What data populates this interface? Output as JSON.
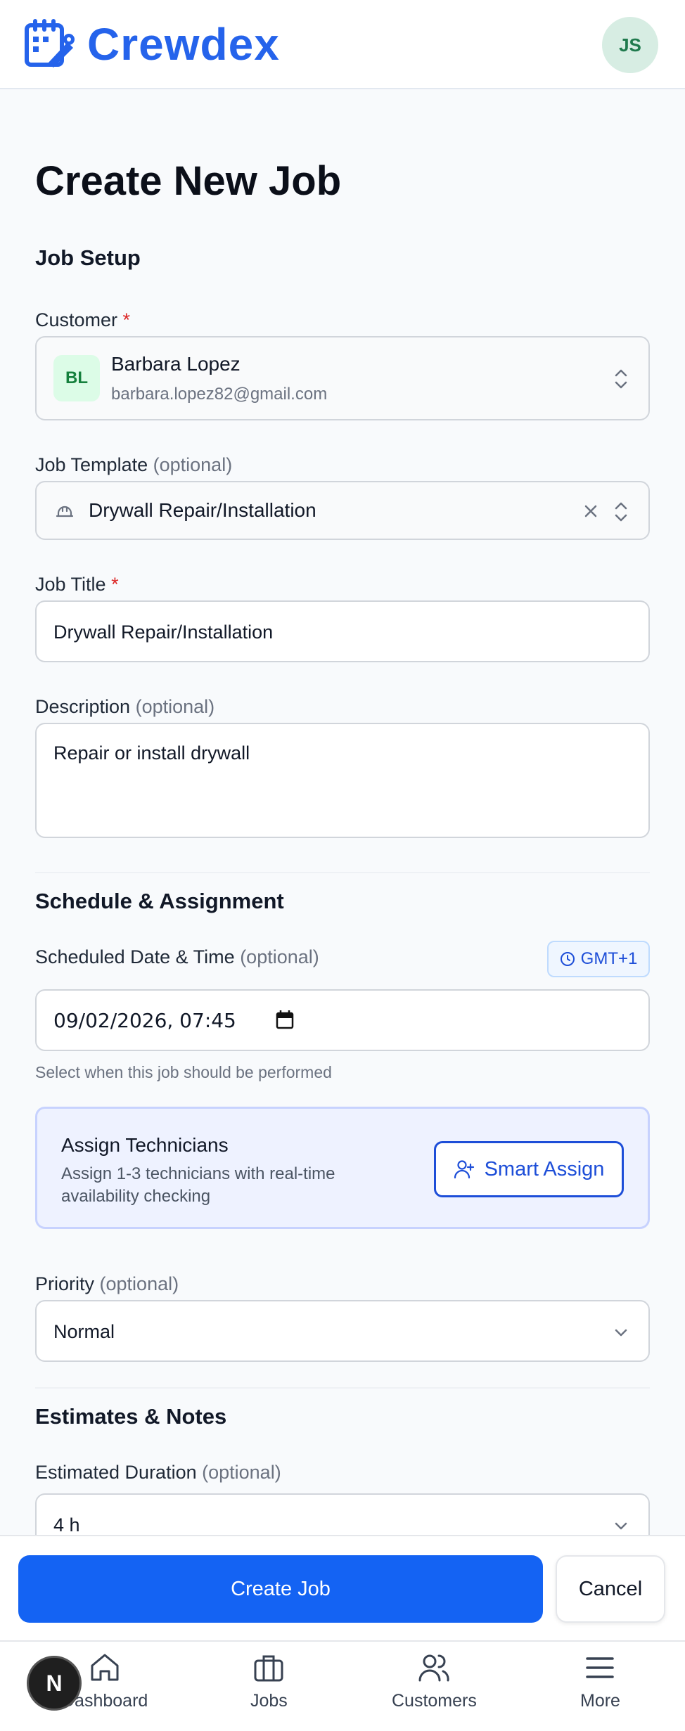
{
  "app": {
    "brand": "Crewdex",
    "user_initials": "JS"
  },
  "page": {
    "title": "Create New Job"
  },
  "job_setup": {
    "section_title": "Job Setup",
    "customer": {
      "label": "Customer",
      "required_mark": "*",
      "initials": "BL",
      "name": "Barbara Lopez",
      "email": "barbara.lopez82@gmail.com"
    },
    "template": {
      "label": "Job Template",
      "optional": "(optional)",
      "value": "Drywall Repair/Installation"
    },
    "job_title": {
      "label": "Job Title",
      "required_mark": "*",
      "value": "Drywall Repair/Installation"
    },
    "description": {
      "label": "Description",
      "optional": "(optional)",
      "value": "Repair or install drywall"
    }
  },
  "schedule": {
    "section_title": "Schedule & Assignment",
    "date_label": "Scheduled Date & Time",
    "date_optional": "(optional)",
    "timezone": "GMT+1",
    "date_value": "09/02/2026, 07:45",
    "helper": "Select when this job should be performed",
    "technicians": {
      "title": "Assign Technicians",
      "subtitle_line1": "Assign 1-3 technicians with real-time",
      "subtitle_line2": "availability checking",
      "button": "Smart Assign"
    },
    "priority": {
      "label": "Priority",
      "optional": "(optional)",
      "value": "Normal"
    }
  },
  "estimates": {
    "section_title": "Estimates & Notes",
    "duration": {
      "label": "Estimated Duration",
      "optional": "(optional)",
      "value": "4 h"
    }
  },
  "actions": {
    "create": "Create Job",
    "cancel": "Cancel"
  },
  "nav": {
    "badge": "N",
    "items": [
      {
        "label": "Dashboard",
        "icon": "home-icon"
      },
      {
        "label": "Jobs",
        "icon": "briefcase-icon"
      },
      {
        "label": "Customers",
        "icon": "users-icon"
      },
      {
        "label": "More",
        "icon": "menu-icon"
      }
    ]
  },
  "colors": {
    "brand": "#2563eb",
    "primary_button": "#1463f3",
    "required": "#dc2626",
    "assign_card_bg": "#eef2ff"
  }
}
